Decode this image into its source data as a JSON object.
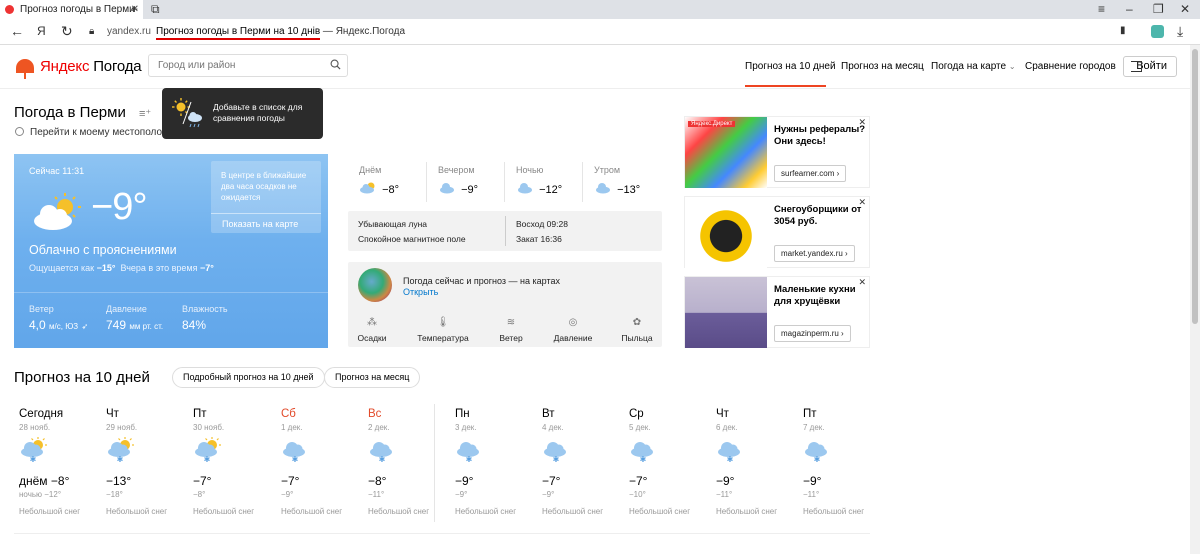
{
  "browser": {
    "tab_title": "Прогноз погоды в Перми",
    "domain": "yandex.ru",
    "page_title_highlight": "Прогноз погоды в Перми на 10 днів",
    "page_title_suffix": " — Яндекс.Погода"
  },
  "header": {
    "logo_brand": "Яндекс",
    "logo_product": "Погода",
    "search_placeholder": "Город или район",
    "nav": [
      "Прогноз на 10 дней",
      "Прогноз на месяц",
      "Погода на карте",
      "Сравнение городов"
    ],
    "login": "Войти"
  },
  "title": {
    "city": "Погода в Перми",
    "locate": "Перейти к моему местоположению",
    "tooltip": "Добавьте в список для сравнения погоды"
  },
  "now": {
    "time": "Сейчас 11:31",
    "temp": "−9°",
    "condition": "Облачно с прояснениями",
    "feels_label": "Ощущается как",
    "feels_value": "−15°",
    "yesterday_label": "Вчера в это время",
    "yesterday_value": "−7°",
    "precip_text": "В центре в ближайшие два часа осадков не ожидается",
    "precip_link": "Показать на карте",
    "wind_label": "Ветер",
    "wind_value": "4,0",
    "wind_unit": "м/с, ЮЗ",
    "pressure_label": "Давление",
    "pressure_value": "749",
    "pressure_unit": "мм рт. ст.",
    "humidity_label": "Влажность",
    "humidity_value": "84%"
  },
  "parts": [
    {
      "label": "Днём",
      "temp": "−8°"
    },
    {
      "label": "Вечером",
      "temp": "−9°"
    },
    {
      "label": "Ночью",
      "temp": "−12°"
    },
    {
      "label": "Утром",
      "temp": "−13°"
    }
  ],
  "sun": {
    "moon": "Убывающая луна",
    "magnetic": "Спокойное магнитное поле",
    "sunrise": "Восход 09:28",
    "sunset": "Закат 16:36"
  },
  "maps": {
    "title": "Погода сейчас и прогноз — на картах",
    "open": "Открыть",
    "items": [
      "Осадки",
      "Температура",
      "Ветер",
      "Давление",
      "Пыльца"
    ]
  },
  "ads": [
    {
      "title": "Нужны рефералы? Они здесь!",
      "button": "surfearner.com ›",
      "label": "Яндекс.Директ"
    },
    {
      "title": "Снегоуборщики от 3054 руб.",
      "button": "market.yandex.ru ›"
    },
    {
      "title": "Маленькие кухни для хрущёвки",
      "button": "magazinperm.ru ›"
    }
  ],
  "forecast": {
    "title": "Прогноз на 10 дней",
    "btn_detailed": "Подробный прогноз на 10 дней",
    "btn_month": "Прогноз на месяц",
    "days": [
      {
        "name": "Сегодня",
        "date": "28 нояб.",
        "hi": "днём −8°",
        "lo": "ночью −12°",
        "cond": "Небольшой снег",
        "weekend": false,
        "sun": true
      },
      {
        "name": "Чт",
        "date": "29 нояб.",
        "hi": "−13°",
        "lo": "−18°",
        "cond": "Небольшой снег",
        "weekend": false,
        "sun": true
      },
      {
        "name": "Пт",
        "date": "30 нояб.",
        "hi": "−7°",
        "lo": "−8°",
        "cond": "Небольшой снег",
        "weekend": false,
        "sun": true
      },
      {
        "name": "Сб",
        "date": "1 дек.",
        "hi": "−7°",
        "lo": "−9°",
        "cond": "Небольшой снег",
        "weekend": true,
        "sun": false
      },
      {
        "name": "Вс",
        "date": "2 дек.",
        "hi": "−8°",
        "lo": "−11°",
        "cond": "Небольшой снег",
        "weekend": true,
        "sun": false
      },
      {
        "name": "Пн",
        "date": "3 дек.",
        "hi": "−9°",
        "lo": "−9°",
        "cond": "Небольшой снег",
        "weekend": false,
        "sun": false
      },
      {
        "name": "Вт",
        "date": "4 дек.",
        "hi": "−7°",
        "lo": "−9°",
        "cond": "Небольшой снег",
        "weekend": false,
        "sun": false
      },
      {
        "name": "Ср",
        "date": "5 дек.",
        "hi": "−7°",
        "lo": "−10°",
        "cond": "Небольшой снег",
        "weekend": false,
        "sun": false
      },
      {
        "name": "Чт",
        "date": "6 дек.",
        "hi": "−9°",
        "lo": "−11°",
        "cond": "Небольшой снег",
        "weekend": false,
        "sun": false
      },
      {
        "name": "Пт",
        "date": "7 дек.",
        "hi": "−9°",
        "lo": "−11°",
        "cond": "Небольшой снег",
        "weekend": false,
        "sun": false
      }
    ]
  },
  "colors": {
    "accent": "#e42a2a",
    "weekend": "#e24b2b",
    "card": "#6eb0ee",
    "link": "#0077cc"
  }
}
